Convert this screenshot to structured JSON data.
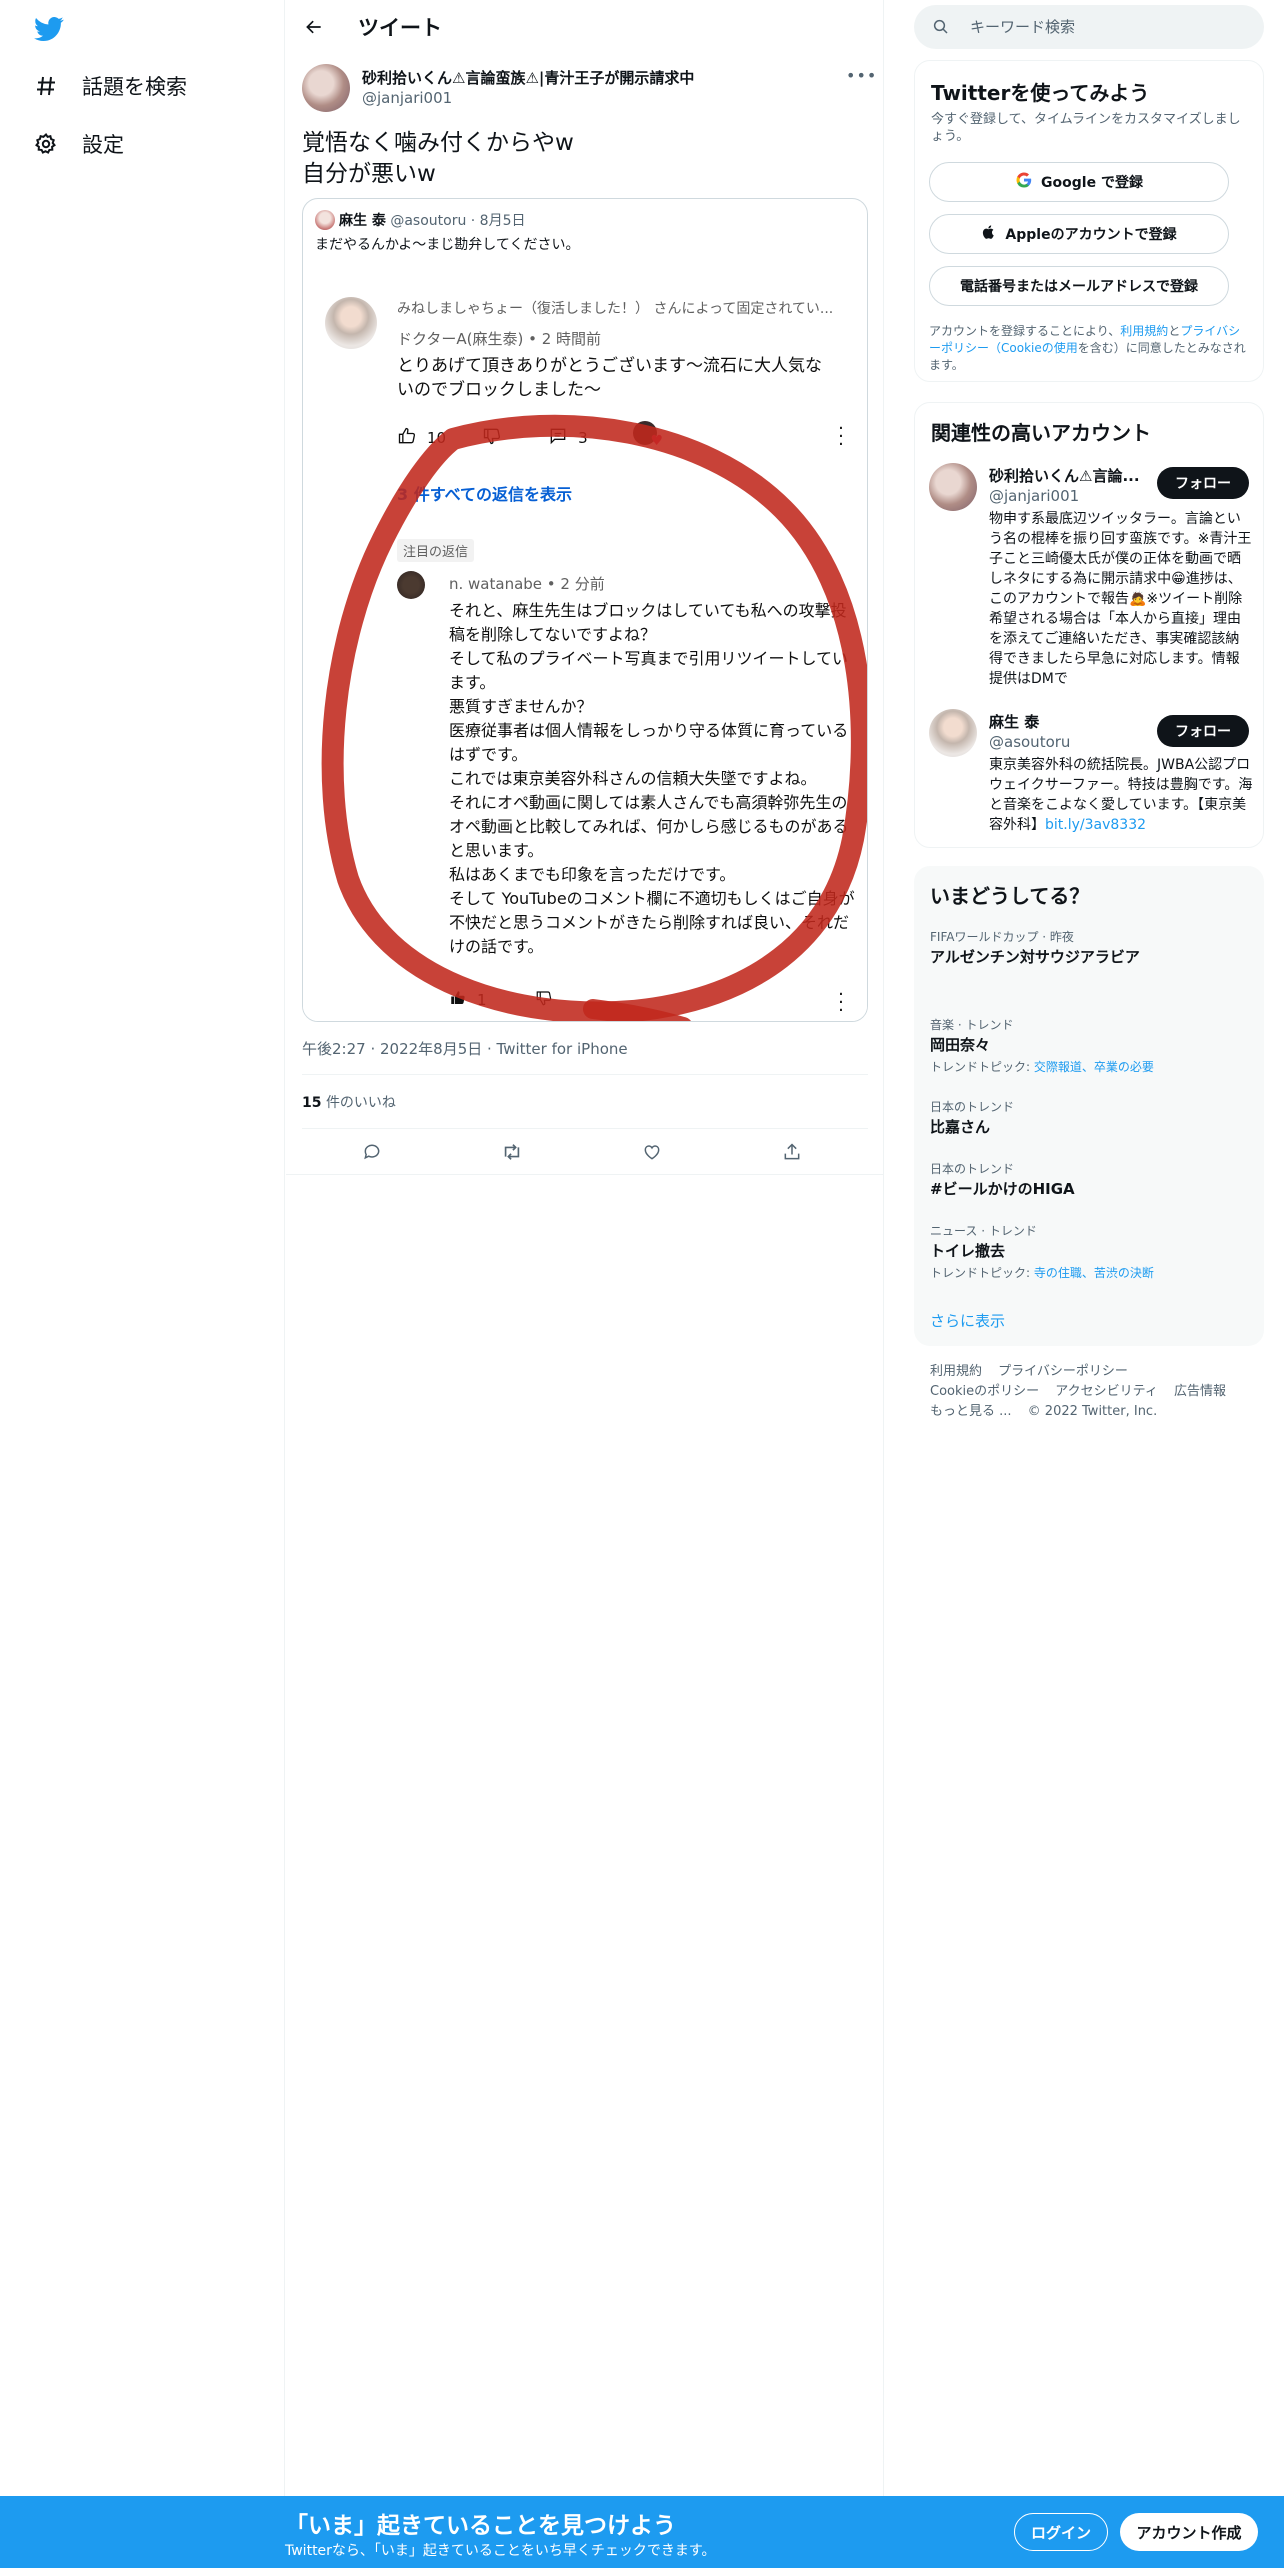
{
  "nav": {
    "explore_label": "話題を検索",
    "settings_label": "設定"
  },
  "header": {
    "title": "ツイート"
  },
  "tweet": {
    "author_name": "砂利拾いくん⚠言論蛮族⚠|青汁王子が開示請求中",
    "author_handle": "@janjari001",
    "text": "覚悟なく噛み付くからやw\n自分が悪いw",
    "time": "午後2:27 · 2022年8月5日 · Twitter for iPhone",
    "likes_count": "15",
    "likes_label": "件のいいね"
  },
  "embedded": {
    "quoted_name": "麻生 泰",
    "quoted_handle": "@asoutoru",
    "quoted_date": "· 8月5日",
    "quoted_text": "まだやるんかよ〜まじ勘弁してください。",
    "pinned_text": "みねしましゃちょー（復活しました！） さんによって固定されてい...",
    "doc_name": "ドクターA(麻生泰) • 2 時間前",
    "doc_text": "とりあげて頂きありがとうございます〜流石に大人気ないのでブロックしました〜",
    "doc_likes": "10",
    "doc_replies": "3",
    "all_replies": "3 件すべての返信を表示",
    "badge": "注目の返信",
    "nw_name": "n. watanabe • 2 分前",
    "nw_text": "それと、麻生先生はブロックはしていても私への攻撃投稿を削除してないですよね？\nそして私のプライベート写真まで引用リツイートしています。\n悪質すぎませんか？\n医療従事者は個人情報をしっかり守る体質に育っているはずです。\nこれでは東京美容外科さんの信頼大失墜ですよね。\nそれにオペ動画に関しては素人さんでも高須幹弥先生のオペ動画と比較してみれば、何かしら感じるものがあると思います。\n私はあくまでも印象を言っただけです。\nそして YouTubeのコメント欄に不適切もしくはご自身が不快だと思うコメントがきたら削除すれば良い、それだけの話です。",
    "nw_likes": "1"
  },
  "sidebar": {
    "search_placeholder": "キーワード検索",
    "signup_title": "Twitterを使ってみよう",
    "signup_sub": "今すぐ登録して、タイムラインをカスタマイズしましょう。",
    "google_btn": "Google で登録",
    "apple_btn": "Appleのアカウントで登録",
    "phone_btn": "電話番号またはメールアドレスで登録",
    "legal_pre": "アカウントを登録することにより、",
    "legal_terms": "利用規約",
    "legal_and": "と",
    "legal_privacy": "プライバシーポリシー",
    "legal_cookie": "（Cookieの使用",
    "legal_post": "を含む）に同意したとみなされます。",
    "accounts_title": "関連性の高いアカウント",
    "accounts": [
      {
        "name": "砂利拾いくん⚠言論...",
        "handle": "@janjari001",
        "follow": "フォロー",
        "bio": "物申す系最底辺ツイッタラー。言論という名の棍棒を振り回す蛮族です。※青汁王子こと三崎優太氏が僕の正体を動画で晒しネタにする為に開示請求中😁進捗は、このアカウントで報告🙇※ツイート削除希望される場合は「本人から直接」理由を添えてご連絡いただき、事実確認該納得できましたら早急に対応します。情報提供はDMで"
      },
      {
        "name": "麻生 泰",
        "handle": "@asoutoru",
        "follow": "フォロー",
        "bio": "東京美容外科の統括院長。JWBA公認プロウェイクサーファー。特技は豊胸です。海と音楽をこよなく愛しています。【東京美容外科】",
        "link": "bit.ly/3av8332"
      }
    ],
    "trends_title": "いまどうしてる？",
    "trends": [
      {
        "category": "FIFAワールドカップ · 昨夜",
        "name": "アルゼンチン対サウジアラビア",
        "topic_label": "",
        "topic_links": ""
      },
      {
        "category": "音楽 · トレンド",
        "name": "岡田奈々",
        "topic_label": "トレンドトピック: ",
        "topic_links": "交際報道、卒業の必要"
      },
      {
        "category": "日本のトレンド",
        "name": "比嘉さん",
        "topic_label": "",
        "topic_links": ""
      },
      {
        "category": "日本のトレンド",
        "name": "#ビールかけのHIGA",
        "topic_label": "",
        "topic_links": ""
      },
      {
        "category": "ニュース · トレンド",
        "name": "トイレ撤去",
        "topic_label": "トレンドトピック: ",
        "topic_links": "寺の住職、苦渋の決断"
      }
    ],
    "show_more": "さらに表示",
    "footer": {
      "terms": "利用規約",
      "privacy": "プライバシーポリシー",
      "cookie": "Cookieのポリシー",
      "accessibility": "アクセシビリティ",
      "ads": "広告情報",
      "more": "もっと見る ...",
      "copyright": "© 2022 Twitter, Inc."
    }
  },
  "banner": {
    "title": "「いま」起きていることを見つけよう",
    "sub": "Twitterなら、「いま」起きていることをいち早くチェックできます。",
    "login": "ログイン",
    "signup": "アカウント作成"
  },
  "colors": {
    "brand": "#1d9bf0",
    "text": "#0f1419",
    "muted": "#536471",
    "youtube_link": "#065fd4",
    "annotation_red": "#c0281c"
  }
}
